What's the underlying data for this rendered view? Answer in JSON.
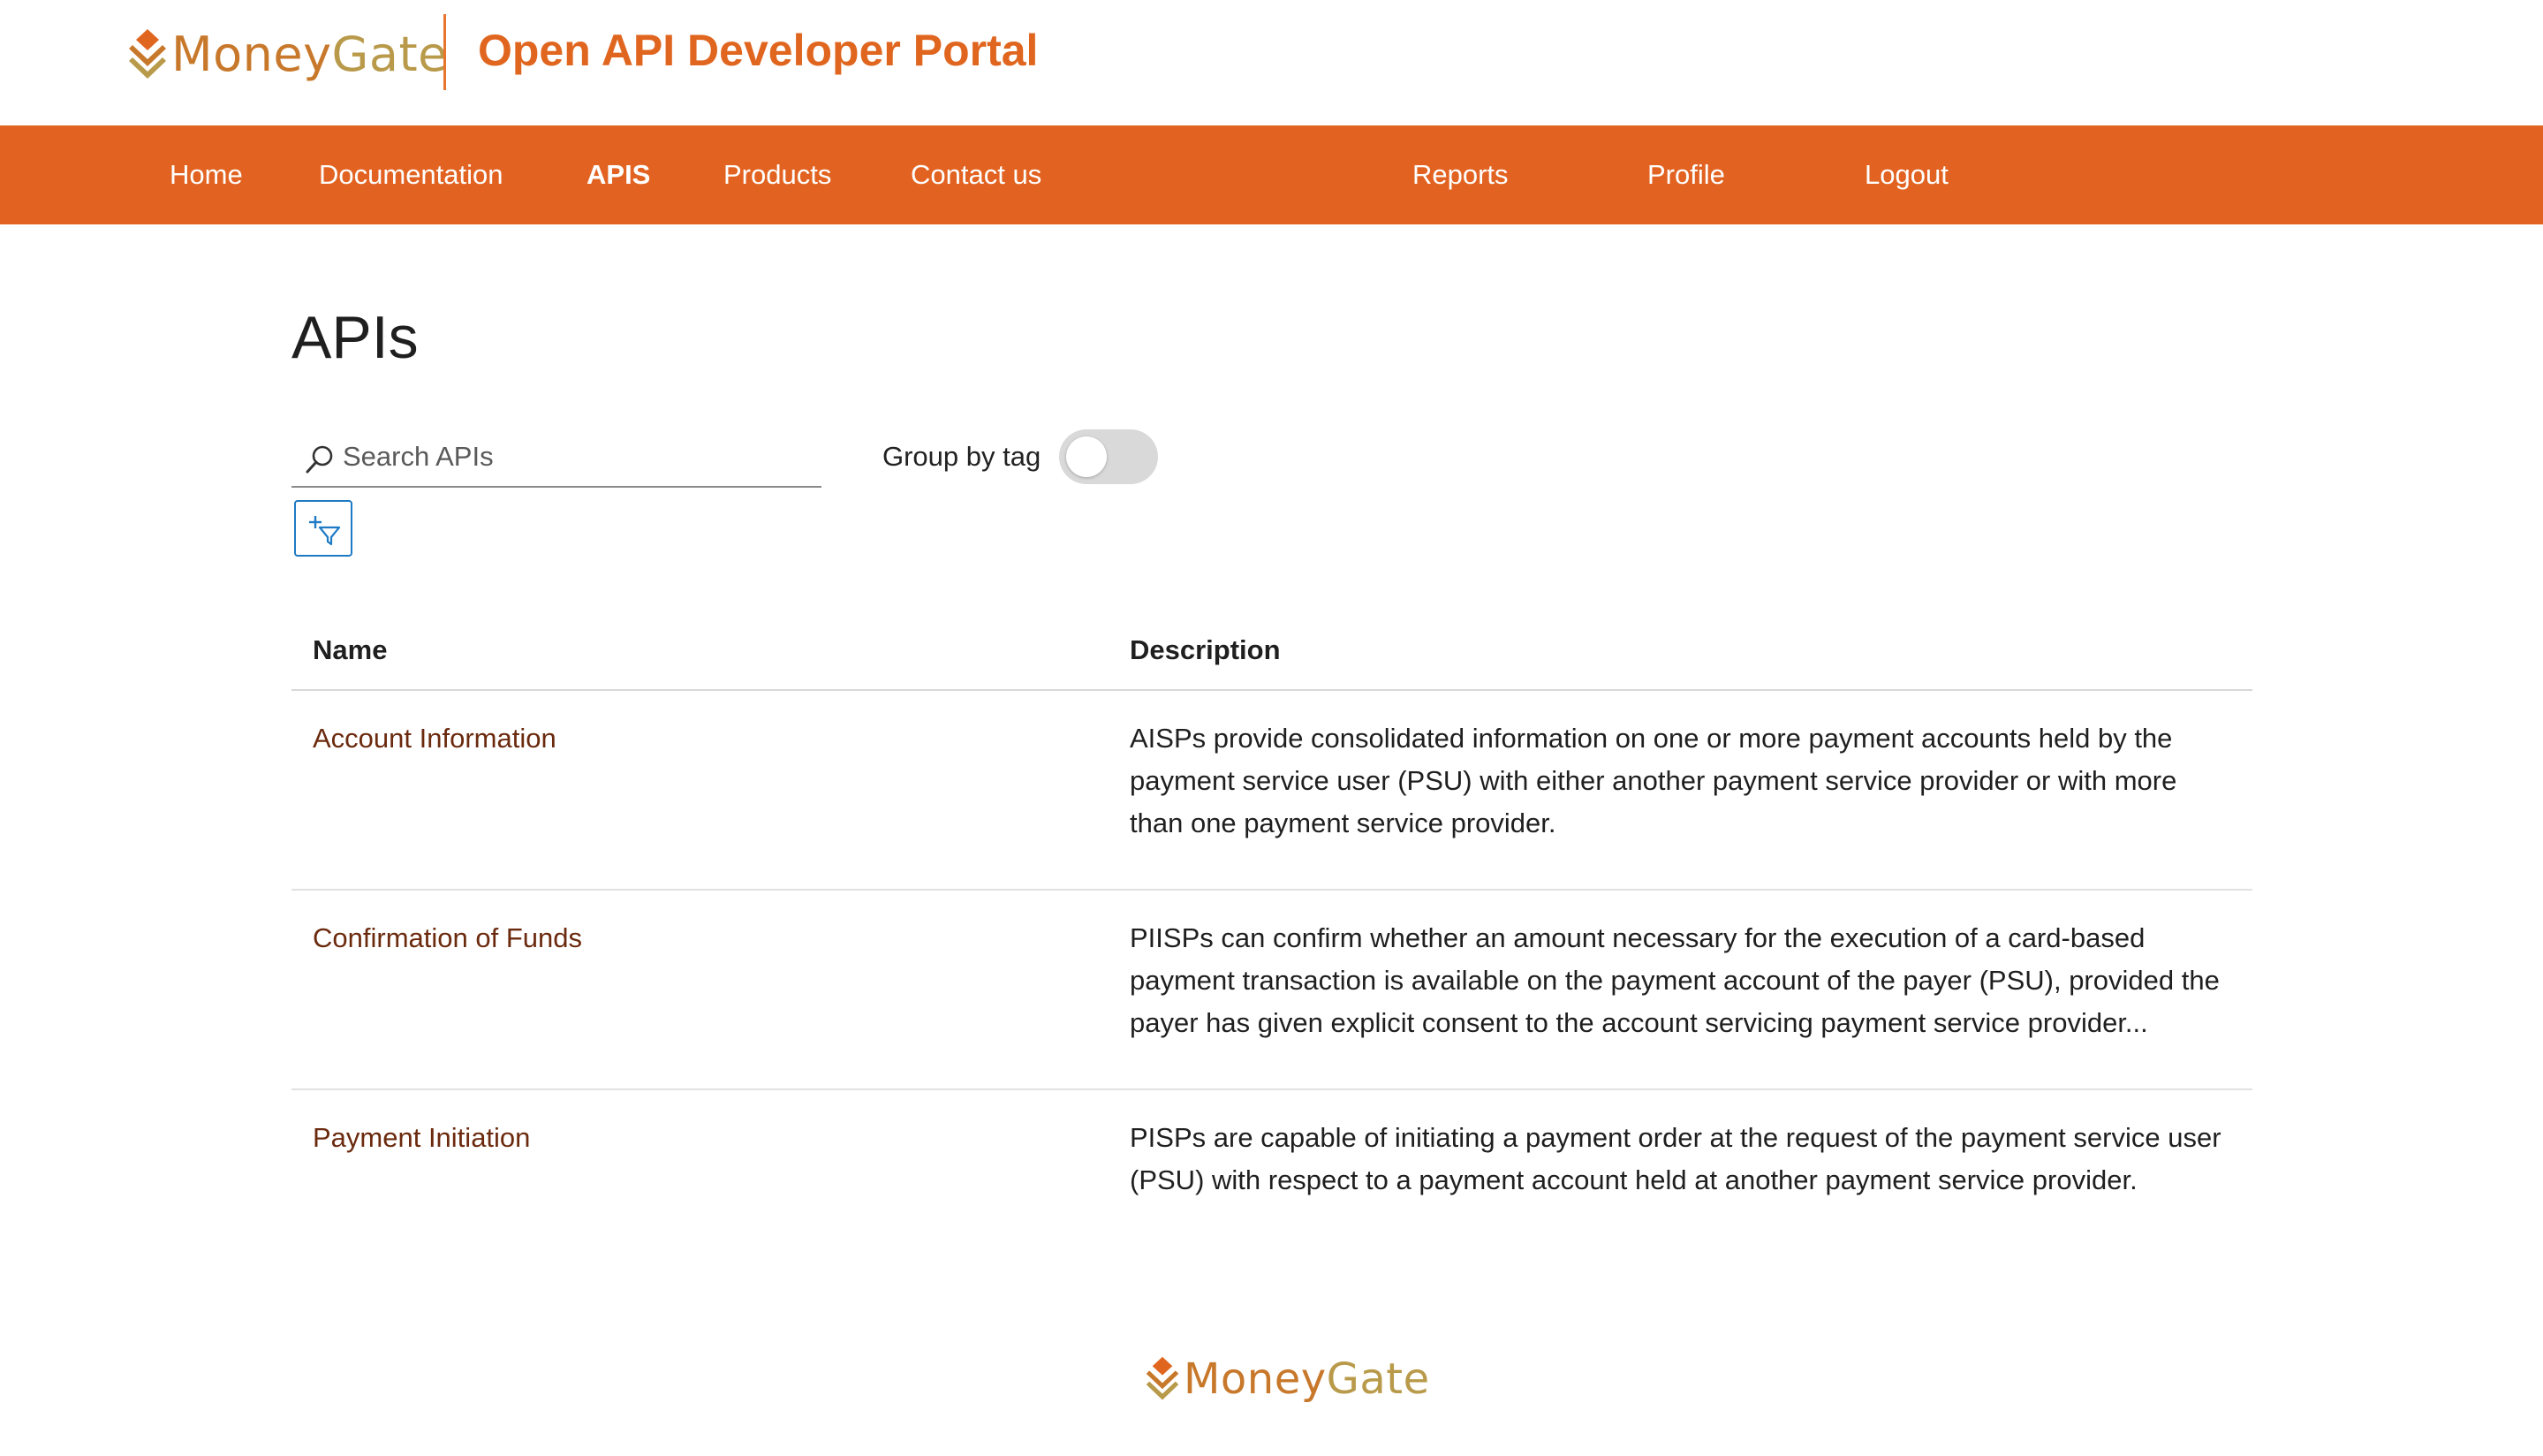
{
  "header": {
    "logo": {
      "word1": "Money",
      "word2": "Gate"
    },
    "portal_title": "Open API Developer Portal"
  },
  "nav": {
    "items": [
      {
        "label": "Home",
        "active": false
      },
      {
        "label": "Documentation",
        "active": false
      },
      {
        "label": "APIS",
        "active": true
      },
      {
        "label": "Products",
        "active": false
      },
      {
        "label": "Contact us",
        "active": false
      },
      {
        "label": "Reports",
        "active": false
      },
      {
        "label": "Profile",
        "active": false
      },
      {
        "label": "Logout",
        "active": false
      }
    ]
  },
  "main": {
    "title": "APIs",
    "search": {
      "placeholder": "Search APIs",
      "value": ""
    },
    "group_by_tag": {
      "label": "Group by tag",
      "enabled": false
    },
    "filter_button": {
      "icon": "add-filter-icon"
    },
    "table": {
      "columns": [
        "Name",
        "Description"
      ],
      "rows": [
        {
          "name": "Account Information",
          "description": "AISPs provide consolidated information on one or more payment accounts held by the payment service user (PSU) with either another payment service provider or with more than one payment service provider."
        },
        {
          "name": "Confirmation of Funds",
          "description": "PIISPs can confirm whether an amount necessary for the execution of a card-based payment transaction is available on the payment account of the payer (PSU), provided the payer has given explicit consent to the account servicing payment service provider..."
        },
        {
          "name": "Payment Initiation",
          "description": "PISPs are capable of initiating a payment order at the request of the payment service user (PSU) with respect to a payment account held at another payment service provider."
        }
      ]
    }
  },
  "footer": {
    "logo": {
      "word1": "Money",
      "word2": "Gate"
    }
  },
  "colors": {
    "brand_orange": "#e26321",
    "title_orange": "#e0661f",
    "link_brown": "#6b2a0e",
    "filter_blue": "#1f7ac4",
    "toggle_off": "#d9d9d9"
  }
}
